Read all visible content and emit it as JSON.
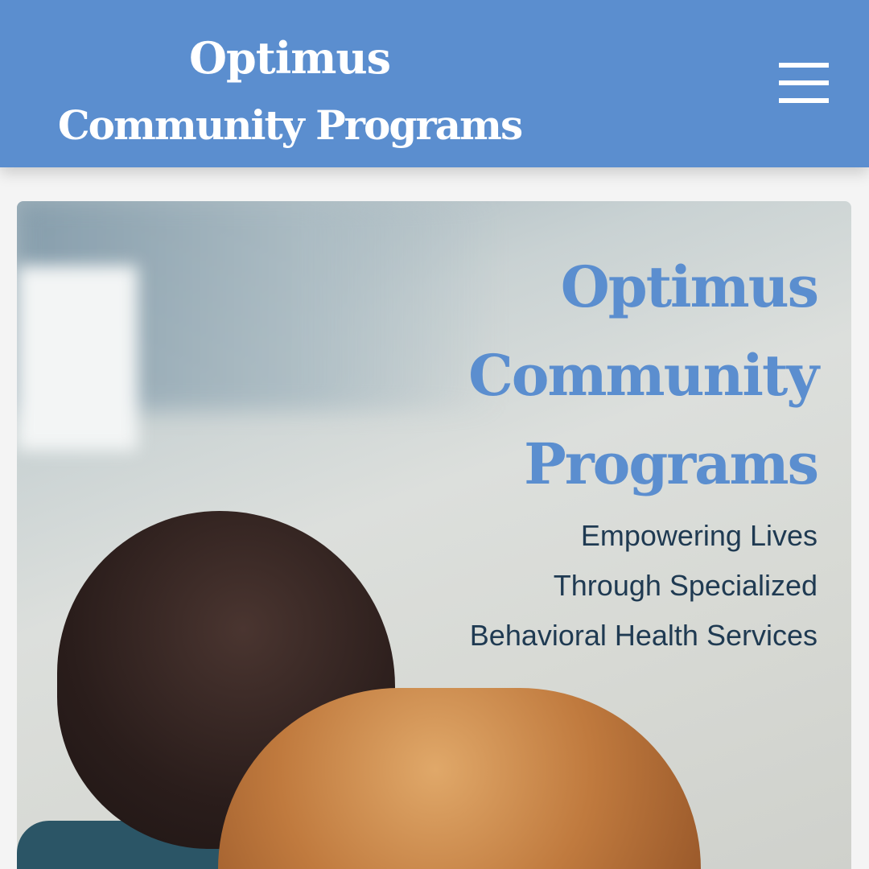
{
  "header": {
    "brand_line1": "Optimus",
    "brand_line2": "Community Programs",
    "menu_icon": "hamburger-menu-icon",
    "background_color": "#5b8ecf"
  },
  "hero": {
    "title_lines": [
      "Optimus",
      "Community",
      "Programs"
    ],
    "subtitle_lines": [
      "Empowering Lives",
      "Through Specialized",
      "Behavioral Health Services"
    ],
    "title_color": "#5b8ecf",
    "subtitle_color": "#1f3a52"
  }
}
